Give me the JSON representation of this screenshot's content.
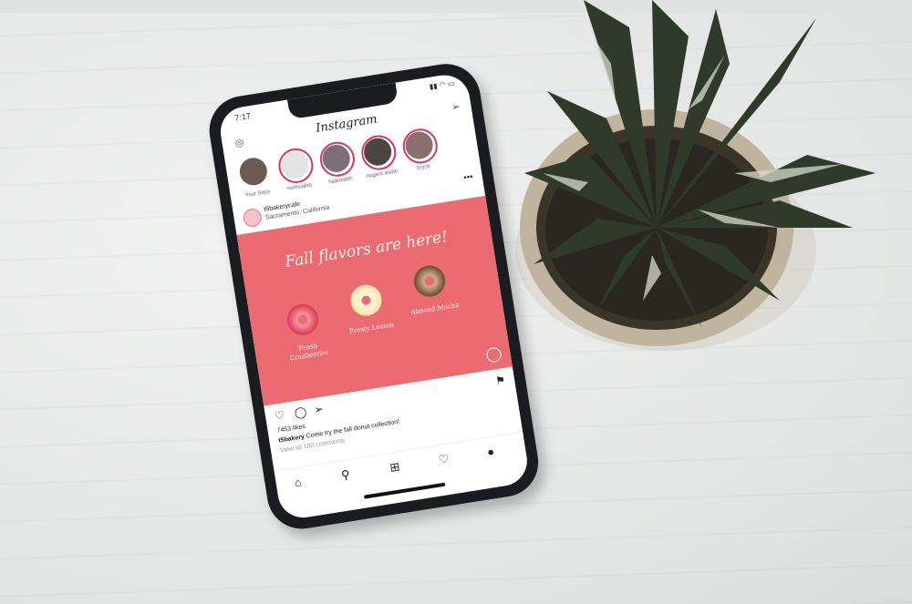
{
  "instagram": {
    "time": "7:17",
    "app_title": "Instagram",
    "stories": [
      {
        "label": "Your Story"
      },
      {
        "label": "northcaleb"
      },
      {
        "label": "haannahh"
      },
      {
        "label": "nugent.leahh"
      },
      {
        "label": "bryce"
      }
    ],
    "post": {
      "username": "t5bakerycafe",
      "location": "Sacramento, California",
      "headline": "Fall flavors are here!",
      "items": [
        {
          "name": "Fresh Cranberries"
        },
        {
          "name": "Frosty Lemon"
        },
        {
          "name": "Almond Mocha"
        }
      ],
      "likes": "7453 likes",
      "caption_user": "t5bakery",
      "caption_text": "Come try the fall donut collection!",
      "comments_link": "View all 100 comments"
    }
  },
  "colors": {
    "post_background": "#ec6b73",
    "story_ring": "#d8336b"
  },
  "icons": [
    "camera-icon",
    "send-icon",
    "more-icon",
    "heart-icon",
    "comment-icon",
    "share-icon",
    "bookmark-icon",
    "home-icon",
    "search-icon",
    "add-icon",
    "activity-icon",
    "profile-icon"
  ]
}
